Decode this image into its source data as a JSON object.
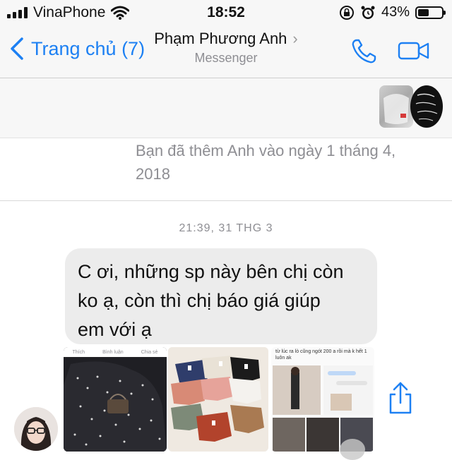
{
  "status_bar": {
    "carrier": "VinaPhone",
    "time": "18:52",
    "battery_percent": "43%",
    "battery_level": 0.43
  },
  "nav": {
    "back_label": "Trang chủ (7)",
    "contact_name": "Phạm Phương Anh",
    "contact_subtitle": "Messenger"
  },
  "system_message": "Bạn đã thêm Anh vào ngày 1 tháng 4, 2018",
  "timestamp": "21:39, 31 THG 3",
  "message": {
    "lines": [
      "C ơi, những sp này bên chị còn",
      "ko ạ, còn thì chị báo giá giúp",
      "em với ạ"
    ]
  },
  "photo_1": {
    "top_labels": [
      "Thích",
      "Bình luận",
      "Chia sẻ"
    ]
  },
  "photo_3": {
    "caption": "từ lúc ra lò cũng ngót 200 a rồi mà k hết 1 luôn ak"
  },
  "icons": [
    "chevron-left-icon",
    "chevron-right-icon",
    "phone-icon",
    "video-camera-icon",
    "share-icon",
    "wifi-icon",
    "lock-rotation-icon",
    "alarm-icon",
    "battery-icon",
    "signal-icon",
    "emoji-icon"
  ],
  "colors": {
    "accent": "#1d80f3",
    "bubble": "#ececec",
    "meta_text": "#8e8e93"
  }
}
